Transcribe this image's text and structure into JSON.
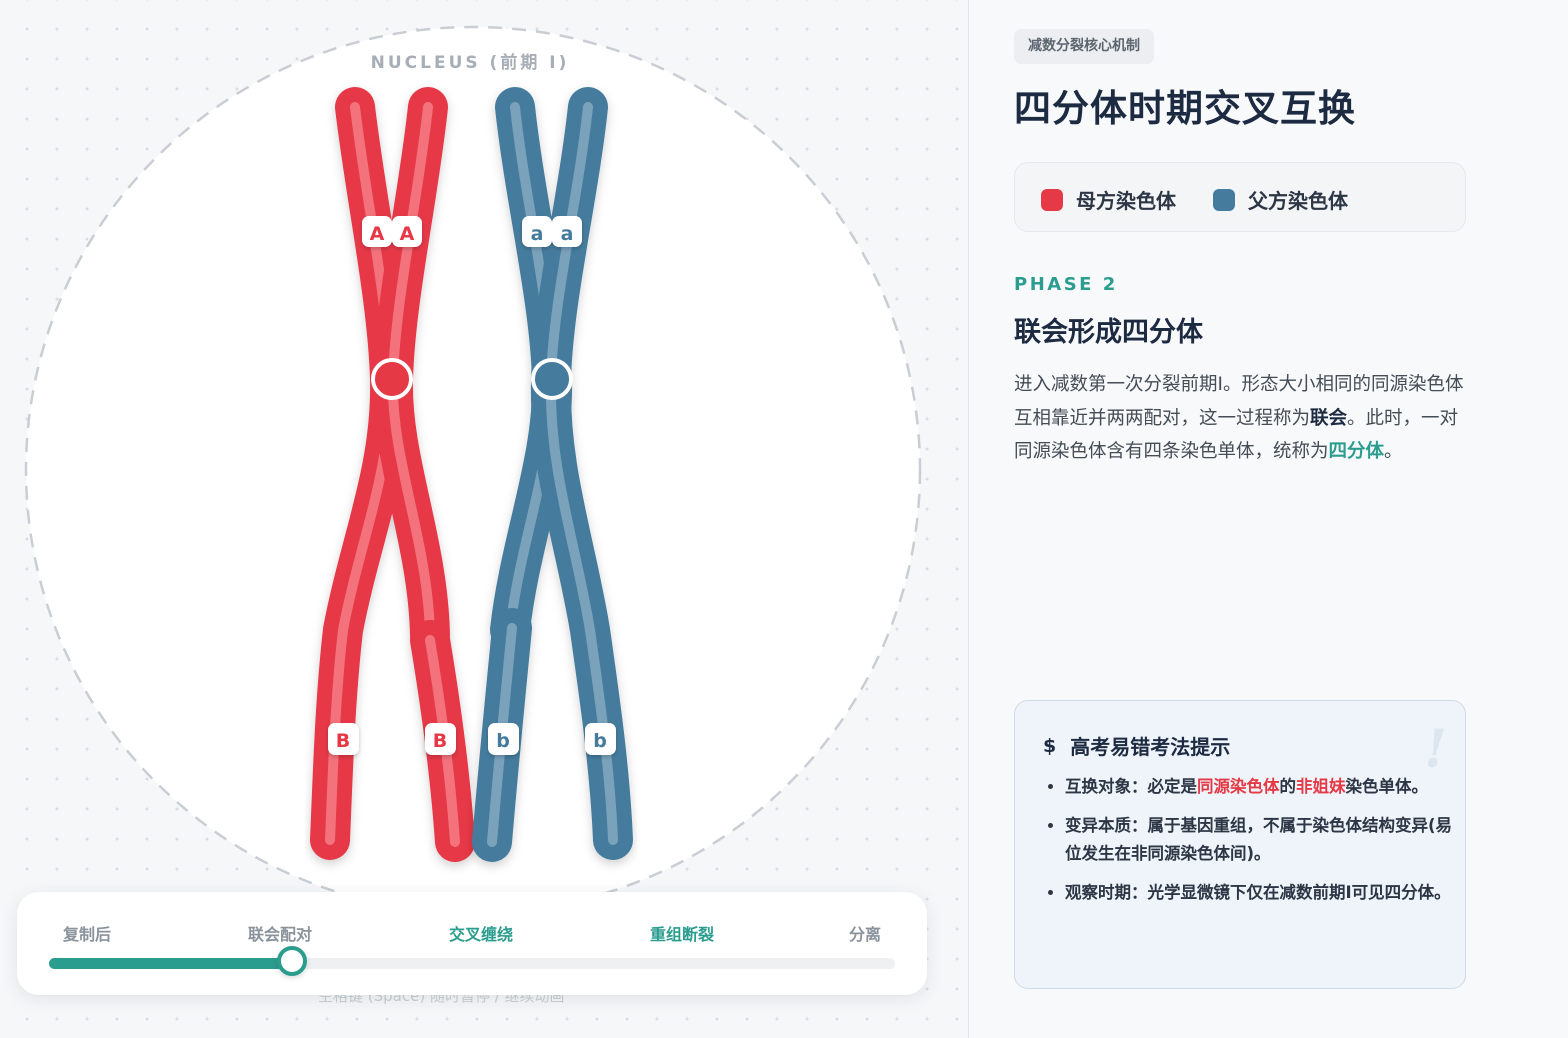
{
  "nucleus_label": "NUCLEUS (前期 I)",
  "genes": {
    "maternal_top": [
      "A",
      "A"
    ],
    "paternal_top": [
      "a",
      "a"
    ],
    "maternal_bottom": [
      "B",
      "B"
    ],
    "paternal_bottom": [
      "b",
      "b"
    ]
  },
  "colors": {
    "maternal": "#e63946",
    "paternal": "#457b9d",
    "accent": "#2a9d8f",
    "title": "#1d2b42"
  },
  "controls": {
    "steps": [
      {
        "label": "复制后",
        "active": false
      },
      {
        "label": "联会配对",
        "active": false
      },
      {
        "label": "交叉缠绕",
        "active": true
      },
      {
        "label": "重组断裂",
        "active": true
      },
      {
        "label": "分离",
        "active": false
      }
    ],
    "progress": 0.287,
    "hint": "空格键 (Space) 随时暂停 / 继续动画"
  },
  "panel": {
    "badge": "减数分裂核心机制",
    "title": "四分体时期交叉互换",
    "legend": [
      {
        "label": "母方染色体",
        "color": "#e63946"
      },
      {
        "label": "父方染色体",
        "color": "#457b9d"
      }
    ],
    "phase": "PHASE 2",
    "subtitle": "联会形成四分体",
    "desc_1": "进入减数第一次分裂前期I。形态大小相同的同源染色体互相靠近并两两配对，这一过程称为",
    "desc_bold": "联会",
    "desc_2": "。此时，一对同源染色体含有四条染色单体，统称为",
    "desc_term": "四分体",
    "desc_3": "。",
    "tip": {
      "title": "高考易错考法提示",
      "icon": "dollar-icon",
      "items": [
        {
          "label": "互换对象：必定是",
          "hl1": "同源染色体",
          "mid": "的",
          "hl2": "非姐妹",
          "rest": "染色单体。"
        },
        {
          "text": "变异本质：属于基因重组，不属于染色体结构变异(易位发生在非同源染色体间)。"
        },
        {
          "text": "观察时期：光学显微镜下仅在减数前期I可见四分体。"
        }
      ]
    }
  }
}
